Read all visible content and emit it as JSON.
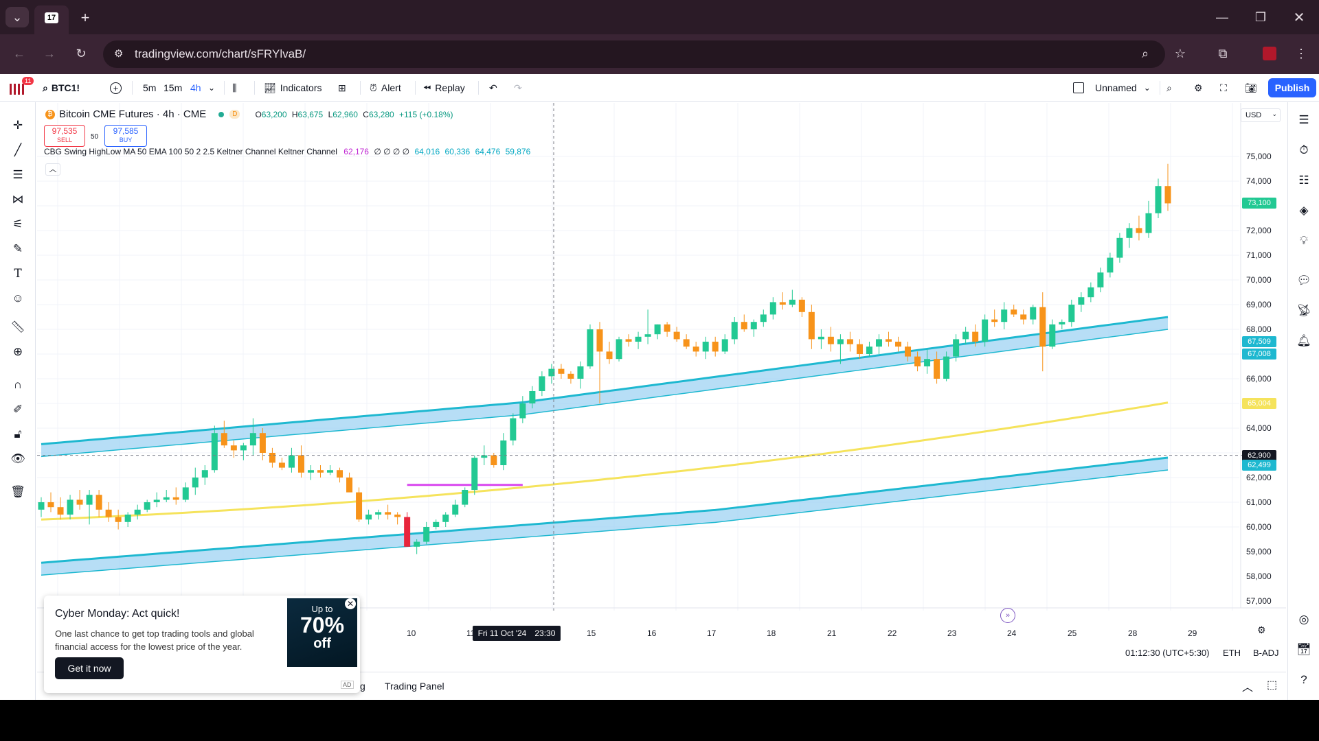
{
  "browser": {
    "url": "tradingview.com/chart/sFRYlvaB/",
    "window_controls": [
      "minimize-icon",
      "restore-icon",
      "close-icon"
    ]
  },
  "toolbar": {
    "notif_count": "11",
    "symbol": "BTC1!",
    "intervals": [
      "5m",
      "15m",
      "4h"
    ],
    "active_interval": "4h",
    "indicators": "Indicators",
    "alert": "Alert",
    "replay": "Replay",
    "layout_name": "Unnamed",
    "publish": "Publish"
  },
  "legend": {
    "title": "Bitcoin CME Futures · 4h · CME",
    "badge": "D",
    "open_label": "O",
    "open": "63,200",
    "high_label": "H",
    "high": "63,675",
    "low_label": "L",
    "low": "62,960",
    "close_label": "C",
    "close": "63,280",
    "change": "+115 (+0.18%)",
    "sell_price": "97,535",
    "sell_label": "SELL",
    "spread": "50",
    "buy_price": "97,585",
    "buy_label": "BUY",
    "indicator_text": "CBG Swing HighLow MA 50 EMA 100 50 2 2.5 Keltner Channel Keltner Channel",
    "ind_v1": "62,176",
    "ind_zeros": "∅ ∅ ∅ ∅",
    "ind_v2": "64,016",
    "ind_v3": "60,336",
    "ind_v4": "64,476",
    "ind_v5": "59,876"
  },
  "price_axis": {
    "currency": "USD",
    "labels": [
      "75,000",
      "74,000",
      "72,000",
      "71,000",
      "70,000",
      "69,000",
      "68,000",
      "66,000",
      "64,000",
      "62,000",
      "61,000",
      "60,000",
      "59,000",
      "58,000",
      "57,000"
    ],
    "tags": {
      "last": "73,100",
      "kc_up1": "67,509",
      "kc_up2": "67,008",
      "ma": "65,004",
      "cross": "62,900",
      "cross2": "62,499"
    }
  },
  "time_axis": {
    "labels": [
      "10",
      "11",
      "15",
      "16",
      "17",
      "18",
      "21",
      "22",
      "23",
      "24",
      "25",
      "28",
      "29"
    ],
    "crosshair_date": "Fri 11 Oct '24",
    "crosshair_time": "23:30"
  },
  "status_bar": {
    "time": "01:12:30 (UTC+5:30)",
    "session": "ETH",
    "adj": "B-ADJ",
    "tab_partial": "g",
    "trading_panel": "Trading Panel"
  },
  "ad": {
    "title": "Cyber Monday: Act quick!",
    "body": "One last chance to get top trading tools and global financial access for the lowest price of the year.",
    "cta": "Get it now",
    "img_line1": "Up to",
    "img_line2": "70%",
    "img_line3": "off",
    "ad_badge": "AD"
  },
  "colors": {
    "up": "#22c993",
    "down": "#f7931a",
    "down_red": "#e8253b",
    "keltner_line": "#1eb8d0",
    "keltner_fill": "#9fd3f3",
    "ma": "#f5e35c",
    "accent": "#2962ff"
  },
  "chart_data": {
    "type": "candlestick",
    "symbol": "BTC1!",
    "interval": "4h",
    "x_labels": [
      "10",
      "11",
      "15",
      "16",
      "17",
      "18",
      "21",
      "22",
      "23",
      "24",
      "25",
      "28",
      "29"
    ],
    "ylim": [
      56500,
      75500
    ],
    "candles": [
      [
        60700,
        61200,
        60400,
        61000
      ],
      [
        61000,
        61400,
        60600,
        60800
      ],
      [
        60800,
        61200,
        60300,
        60500
      ],
      [
        60500,
        61300,
        60300,
        61100
      ],
      [
        61100,
        61500,
        60700,
        60900
      ],
      [
        60900,
        61500,
        60100,
        61300
      ],
      [
        61300,
        61500,
        60400,
        60700
      ],
      [
        60700,
        61000,
        60200,
        60400
      ],
      [
        60400,
        60700,
        59900,
        60200
      ],
      [
        60200,
        60600,
        60000,
        60500
      ],
      [
        60500,
        60900,
        60300,
        60700
      ],
      [
        60700,
        61100,
        60600,
        61000
      ],
      [
        61000,
        61400,
        60800,
        61100
      ],
      [
        61100,
        61500,
        61000,
        61200
      ],
      [
        61200,
        61600,
        60900,
        61100
      ],
      [
        61100,
        61800,
        61000,
        61600
      ],
      [
        61600,
        62400,
        61300,
        62000
      ],
      [
        62000,
        62500,
        61700,
        62300
      ],
      [
        62300,
        64100,
        62200,
        63800
      ],
      [
        63800,
        64300,
        63200,
        63300
      ],
      [
        63300,
        63500,
        62800,
        63100
      ],
      [
        63100,
        63400,
        62700,
        63300
      ],
      [
        63300,
        64400,
        62900,
        63800
      ],
      [
        63800,
        64000,
        62700,
        63000
      ],
      [
        63000,
        63200,
        62400,
        62600
      ],
      [
        62600,
        62800,
        62300,
        62400
      ],
      [
        62400,
        63200,
        62200,
        62900
      ],
      [
        62900,
        63300,
        62000,
        62200
      ],
      [
        62200,
        62500,
        61900,
        62300
      ],
      [
        62300,
        62500,
        62000,
        62200
      ],
      [
        62200,
        62500,
        62100,
        62300
      ],
      [
        62300,
        62400,
        61800,
        62000
      ],
      [
        62000,
        62200,
        61500,
        61400
      ],
      [
        61400,
        61600,
        60200,
        60300
      ],
      [
        60300,
        60700,
        60100,
        60500
      ],
      [
        60500,
        60700,
        60300,
        60600
      ],
      [
        60600,
        60900,
        60300,
        60500
      ],
      [
        60500,
        60600,
        60100,
        60400
      ],
      [
        60400,
        60600,
        59200,
        59200
      ],
      [
        59200,
        59500,
        58900,
        59400
      ],
      [
        59400,
        60200,
        59300,
        60000
      ],
      [
        60000,
        60300,
        59900,
        60200
      ],
      [
        60200,
        60600,
        60000,
        60500
      ],
      [
        60500,
        61100,
        60400,
        60900
      ],
      [
        60900,
        61600,
        60800,
        61500
      ],
      [
        61500,
        62900,
        61300,
        62800
      ],
      [
        62800,
        63300,
        62500,
        62900
      ],
      [
        62900,
        63000,
        62400,
        62500
      ],
      [
        62500,
        63800,
        62300,
        63500
      ],
      [
        63500,
        64600,
        63300,
        64400
      ],
      [
        64400,
        65300,
        64200,
        65000
      ],
      [
        65000,
        65700,
        64800,
        65500
      ],
      [
        65500,
        66300,
        65300,
        66100
      ],
      [
        66100,
        66600,
        65800,
        66400
      ],
      [
        66400,
        66600,
        66000,
        66200
      ],
      [
        66200,
        66300,
        65800,
        66000
      ],
      [
        66000,
        66700,
        65600,
        66500
      ],
      [
        66500,
        68200,
        66400,
        68000
      ],
      [
        68000,
        68300,
        65000,
        67100
      ],
      [
        67100,
        67500,
        66600,
        66800
      ],
      [
        66800,
        67700,
        66700,
        67600
      ],
      [
        67600,
        67800,
        67300,
        67500
      ],
      [
        67500,
        67900,
        67200,
        67700
      ],
      [
        67700,
        68800,
        67400,
        67800
      ],
      [
        67800,
        68200,
        67600,
        68200
      ],
      [
        68200,
        68300,
        67700,
        67900
      ],
      [
        67900,
        68100,
        67500,
        67600
      ],
      [
        67600,
        67800,
        67200,
        67300
      ],
      [
        67300,
        67500,
        66900,
        67100
      ],
      [
        67100,
        67700,
        66800,
        67500
      ],
      [
        67500,
        67700,
        66900,
        67100
      ],
      [
        67100,
        67800,
        67000,
        67600
      ],
      [
        67600,
        68500,
        67400,
        68300
      ],
      [
        68300,
        68600,
        67900,
        68000
      ],
      [
        68000,
        68400,
        67700,
        68300
      ],
      [
        68300,
        68800,
        68100,
        68600
      ],
      [
        68600,
        69300,
        68400,
        69100
      ],
      [
        69100,
        69500,
        68800,
        69000
      ],
      [
        69000,
        69600,
        68900,
        69200
      ],
      [
        69200,
        69300,
        68500,
        68700
      ],
      [
        68700,
        69000,
        67200,
        67600
      ],
      [
        67600,
        68000,
        67200,
        67700
      ],
      [
        67700,
        68100,
        67100,
        67400
      ],
      [
        67400,
        67800,
        66600,
        67600
      ],
      [
        67600,
        67900,
        67100,
        67400
      ],
      [
        67400,
        67600,
        66800,
        67000
      ],
      [
        67000,
        67500,
        66900,
        67300
      ],
      [
        67300,
        67800,
        67000,
        67600
      ],
      [
        67600,
        67900,
        67300,
        67500
      ],
      [
        67500,
        67700,
        67100,
        67300
      ],
      [
        67300,
        67500,
        66700,
        66900
      ],
      [
        66900,
        67100,
        66300,
        66500
      ],
      [
        66500,
        67200,
        66200,
        66800
      ],
      [
        66800,
        67100,
        65800,
        66000
      ],
      [
        66000,
        67100,
        65900,
        66900
      ],
      [
        66900,
        67800,
        66700,
        67600
      ],
      [
        67600,
        68100,
        67400,
        67900
      ],
      [
        67900,
        68200,
        67300,
        67500
      ],
      [
        67500,
        68600,
        67300,
        68400
      ],
      [
        68400,
        68800,
        68100,
        68300
      ],
      [
        68300,
        69100,
        68000,
        68800
      ],
      [
        68800,
        69000,
        68500,
        68600
      ],
      [
        68600,
        68800,
        68200,
        68400
      ],
      [
        68400,
        69000,
        68200,
        68900
      ],
      [
        68900,
        69500,
        66300,
        67300
      ],
      [
        67300,
        68400,
        67200,
        68200
      ],
      [
        68200,
        68400,
        68000,
        68300
      ],
      [
        68300,
        69200,
        68100,
        69000
      ],
      [
        69000,
        69500,
        68700,
        69300
      ],
      [
        69300,
        69900,
        69100,
        69700
      ],
      [
        69700,
        70500,
        69500,
        70300
      ],
      [
        70300,
        71100,
        70100,
        70900
      ],
      [
        70900,
        71900,
        70700,
        71700
      ],
      [
        71700,
        72300,
        71300,
        72100
      ],
      [
        72100,
        72600,
        71600,
        71900
      ],
      [
        71900,
        73200,
        71700,
        72700
      ],
      [
        72700,
        74100,
        72500,
        73800
      ],
      [
        73800,
        74700,
        72800,
        73100
      ]
    ],
    "keltner_upper_top_labels": [
      "64,016",
      "64,476"
    ],
    "keltner_lower_labels": [
      "60,336",
      "59,876"
    ],
    "ma_label": "62,176"
  }
}
